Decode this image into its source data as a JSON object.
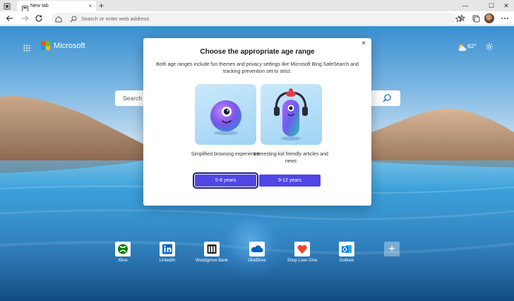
{
  "browser": {
    "tab_title": "New tab",
    "tab_close": "×",
    "new_tab": "+",
    "window_controls": {
      "minimize": "—",
      "maximize": "☐",
      "close": "✕"
    },
    "address_placeholder": "Search or enter web address"
  },
  "ntp": {
    "brand": "Microsoft",
    "weather_temp": "62°",
    "search_placeholder": "Search"
  },
  "modal": {
    "close": "×",
    "title": "Choose the appropriate age range",
    "description": "Both age ranges include fun themes and privacy settings like Microsoft Bing SafeSearch and tracking prevention set to strict.",
    "options": [
      {
        "caption": "Simplified browsing experience",
        "button": "5-8 years",
        "selected": true
      },
      {
        "caption": "Interesting kid friendly articles and news",
        "button": "9-12 years",
        "selected": false
      }
    ]
  },
  "quick_links": [
    {
      "label": "Xbox",
      "icon": "xbox-icon"
    },
    {
      "label": "LinkedIn",
      "icon": "linkedin-icon"
    },
    {
      "label": "Woodgrove Bank",
      "icon": "woodgrove-bank-icon"
    },
    {
      "label": "OneDrive",
      "icon": "onedrive-icon"
    },
    {
      "label": "Shop Love Give",
      "icon": "shop-love-give-icon"
    },
    {
      "label": "Outlook",
      "icon": "outlook-icon"
    }
  ],
  "colors": {
    "accent": "#4f46e5",
    "ms_red": "#f25022",
    "ms_green": "#7fba00",
    "ms_blue": "#00a4ef",
    "ms_yellow": "#ffb900"
  }
}
